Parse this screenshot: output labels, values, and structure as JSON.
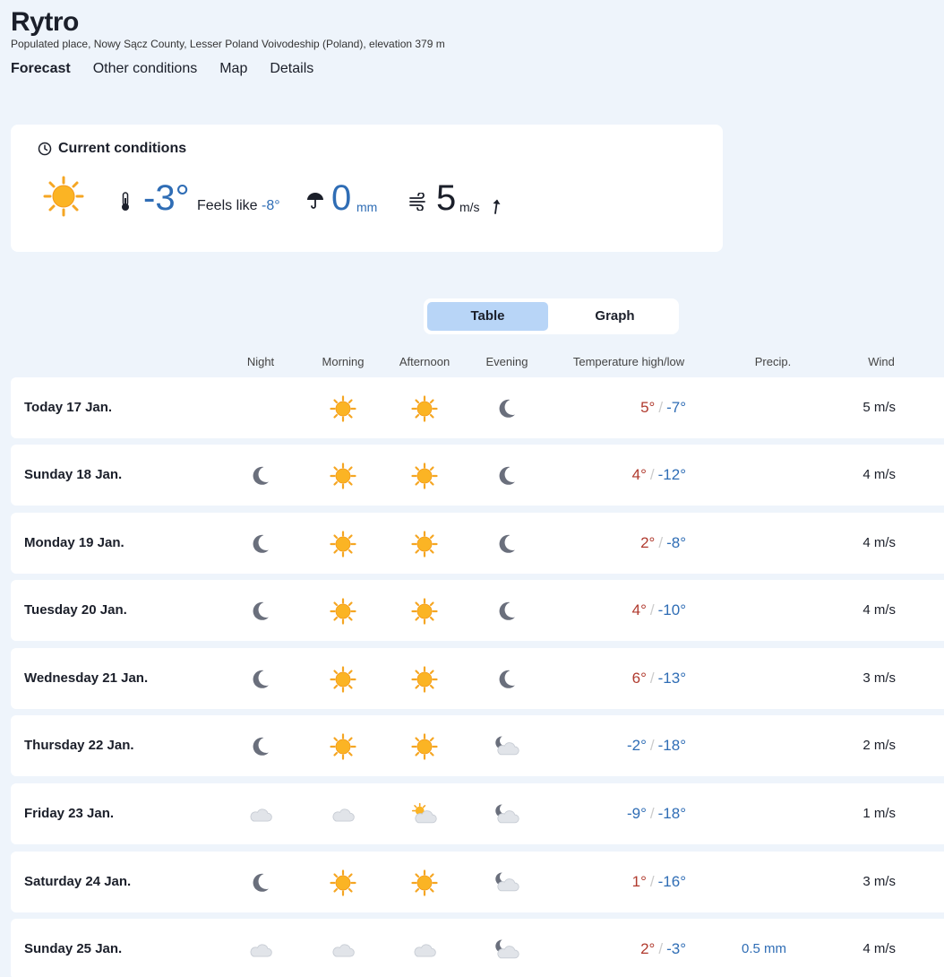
{
  "place": {
    "name": "Rytro",
    "subtitle": "Populated place, Nowy Sącz County, Lesser Poland Voivodeship (Poland), elevation 379 m"
  },
  "nav": [
    "Forecast",
    "Other conditions",
    "Map",
    "Details"
  ],
  "current": {
    "header": "Current conditions",
    "icon": "sun-icon",
    "temp": "-3°",
    "feels_label": "Feels like",
    "feels_value": "-8°",
    "precip": "0",
    "precip_unit": "mm",
    "wind": "5",
    "wind_unit": "m/s"
  },
  "toggle": {
    "table": "Table",
    "graph": "Graph"
  },
  "columns": {
    "night": "Night",
    "morning": "Morning",
    "afternoon": "Afternoon",
    "evening": "Evening",
    "temperature": "Temperature high/low",
    "precip": "Precip.",
    "wind": "Wind"
  },
  "rows": [
    {
      "day": "Today 17 Jan.",
      "icons": [
        "",
        "sun",
        "sun",
        "moon"
      ],
      "high": "5°",
      "low": "-7°",
      "high_cold": false,
      "precip": "",
      "wind": "5 m/s"
    },
    {
      "day": "Sunday 18 Jan.",
      "icons": [
        "moon",
        "sun",
        "sun",
        "moon"
      ],
      "high": "4°",
      "low": "-12°",
      "high_cold": false,
      "precip": "",
      "wind": "4 m/s"
    },
    {
      "day": "Monday 19 Jan.",
      "icons": [
        "moon",
        "sun",
        "sun",
        "moon"
      ],
      "high": "2°",
      "low": "-8°",
      "high_cold": false,
      "precip": "",
      "wind": "4 m/s"
    },
    {
      "day": "Tuesday 20 Jan.",
      "icons": [
        "moon",
        "sun",
        "sun",
        "moon"
      ],
      "high": "4°",
      "low": "-10°",
      "high_cold": false,
      "precip": "",
      "wind": "4 m/s"
    },
    {
      "day": "Wednesday 21 Jan.",
      "icons": [
        "moon",
        "sun",
        "sun",
        "moon"
      ],
      "high": "6°",
      "low": "-13°",
      "high_cold": false,
      "precip": "",
      "wind": "3 m/s"
    },
    {
      "day": "Thursday 22 Jan.",
      "icons": [
        "moon",
        "sun",
        "sun",
        "moon-cloud"
      ],
      "high": "-2°",
      "low": "-18°",
      "high_cold": true,
      "precip": "",
      "wind": "2 m/s"
    },
    {
      "day": "Friday 23 Jan.",
      "icons": [
        "cloud",
        "cloud",
        "sun-cloud",
        "moon-cloud"
      ],
      "high": "-9°",
      "low": "-18°",
      "high_cold": true,
      "precip": "",
      "wind": "1 m/s"
    },
    {
      "day": "Saturday 24 Jan.",
      "icons": [
        "moon",
        "sun",
        "sun",
        "moon-cloud"
      ],
      "high": "1°",
      "low": "-16°",
      "high_cold": false,
      "precip": "",
      "wind": "3 m/s"
    },
    {
      "day": "Sunday 25 Jan.",
      "icons": [
        "cloud",
        "cloud",
        "cloud",
        "moon-cloud"
      ],
      "high": "2°",
      "low": "-3°",
      "high_cold": false,
      "precip": "0.5 mm",
      "wind": "4 m/s"
    }
  ]
}
